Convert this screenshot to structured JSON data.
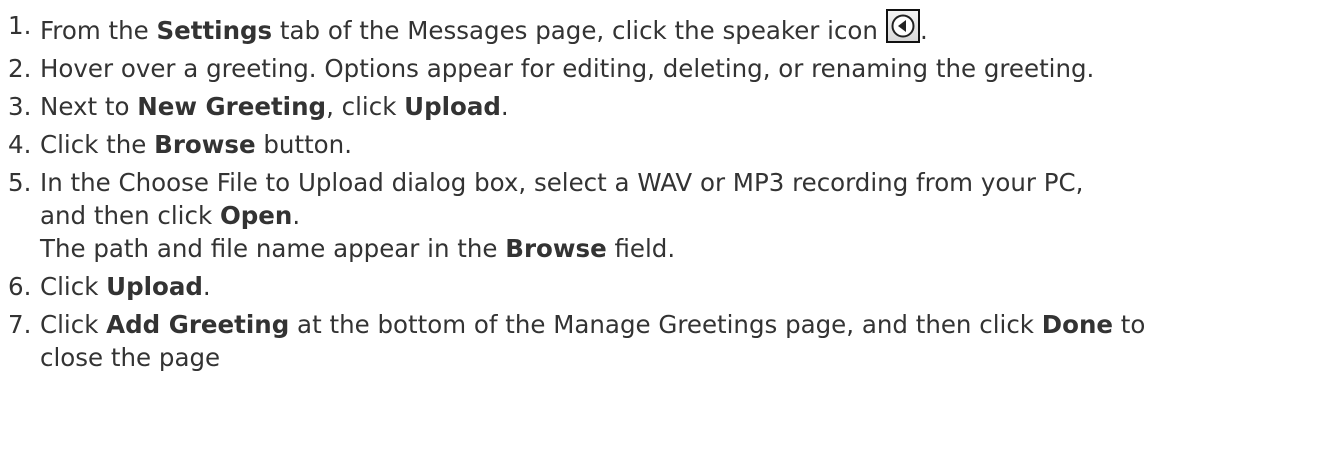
{
  "steps": [
    {
      "num": "1.",
      "parts": [
        "From the ",
        "Settings",
        " tab of the Messages page, click the speaker icon",
        "."
      ]
    },
    {
      "num": "2.",
      "text": "Hover over a greeting. Options appear for editing, deleting, or renaming the greeting."
    },
    {
      "num": "3.",
      "parts": [
        "Next to ",
        "New Greeting",
        ", click ",
        "Upload",
        "."
      ]
    },
    {
      "num": "4.",
      "parts": [
        "Click the ",
        "Browse",
        " button."
      ]
    },
    {
      "num": "5.",
      "line1": "In the Choose File to Upload dialog box, select a WAV or MP3 recording from your PC,",
      "line2": [
        "and then click ",
        "Open",
        "."
      ],
      "line3": [
        "The path and file name appear in the ",
        "Browse",
        " field."
      ]
    },
    {
      "num": "6.",
      "parts": [
        "Click ",
        "Upload",
        "."
      ]
    },
    {
      "num": "7.",
      "line1": [
        "Click ",
        "Add Greeting",
        " at the bottom of the Manage Greetings page, and then click ",
        "Done",
        " to"
      ],
      "line2": "close the page"
    }
  ],
  "icons": {
    "speaker": "speaker-icon"
  }
}
